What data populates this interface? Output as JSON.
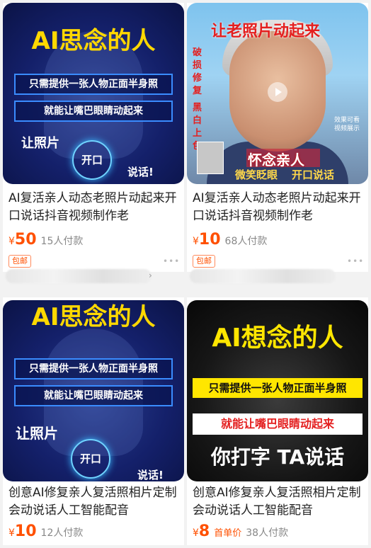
{
  "products": [
    {
      "title": "AI复活亲人动态老照片动起来开口说话抖音视频制作老",
      "yen": "¥",
      "price": "50",
      "paid": "15人付款",
      "badge": "包邮",
      "thumb": {
        "headline": "AI思念的人",
        "line1": "只需提供一张人物正面半身照",
        "line2": "就能让嘴巴眼睛动起来",
        "left_text": "让照片",
        "ring_text": "开口",
        "right_text": "说话!"
      }
    },
    {
      "title": "AI复活亲人动态老照片动起来开口说话抖音视频制作老",
      "yen": "¥",
      "price": "10",
      "paid": "68人付款",
      "badge": "包邮",
      "thumb": {
        "headline": "让老照片动起来",
        "side1": "破损修复",
        "side2": "黑白上色",
        "caption": "怀念亲人",
        "bottom_left": "微笑眨眼",
        "bottom_right": "开口说话",
        "watermark": "效果可看视频展示"
      }
    },
    {
      "title": "创意AI修复亲人复活照相片定制会动说话人工智能配音",
      "yen": "¥",
      "price": "10",
      "paid": "12人付款",
      "thumb": {
        "headline": "AI思念的人",
        "line1": "只需提供一张人物正面半身照",
        "line2": "就能让嘴巴眼睛动起来",
        "left_text": "让照片",
        "ring_text": "开口",
        "right_text": "说话!"
      }
    },
    {
      "title": "创意AI修复亲人复活照相片定制会动说话人工智能配音",
      "yen": "¥",
      "price": "8",
      "first_tag": "首单价",
      "paid": "38人付款",
      "thumb": {
        "headline": "AI想念的人",
        "line1": "只需提供一张人物正面半身照",
        "line2": "就能让嘴巴眼睛动起来",
        "line3": "你打字 TA说话"
      }
    }
  ],
  "more_icon": "ellipsis-icon",
  "colors": {
    "price": "#ff5000",
    "headline_yellow": "#ffd800",
    "red": "#e41f1f"
  }
}
